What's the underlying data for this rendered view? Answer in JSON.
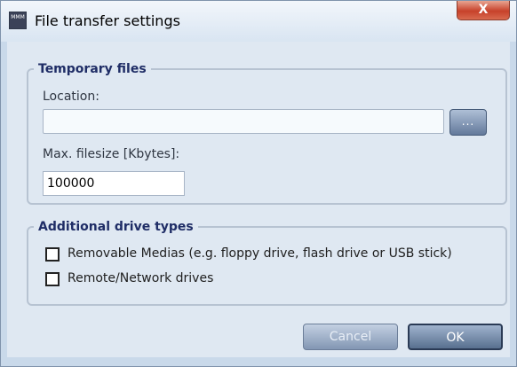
{
  "window": {
    "title": "File transfer settings",
    "icon_text": "MMM",
    "close_label": "X"
  },
  "temporary_files": {
    "group_title": "Temporary files",
    "location_label": "Location:",
    "location_value": "",
    "browse_label": "...",
    "max_filesize_label": "Max. filesize [Kbytes]:",
    "max_filesize_value": "100000"
  },
  "additional_drive_types": {
    "group_title": "Additional drive types",
    "options": [
      {
        "label": "Removable Medias (e.g. floppy drive, flash drive or USB stick)",
        "checked": false
      },
      {
        "label": "Remote/Network drives",
        "checked": false
      }
    ]
  },
  "buttons": {
    "cancel_label": "Cancel",
    "ok_label": "OK"
  }
}
